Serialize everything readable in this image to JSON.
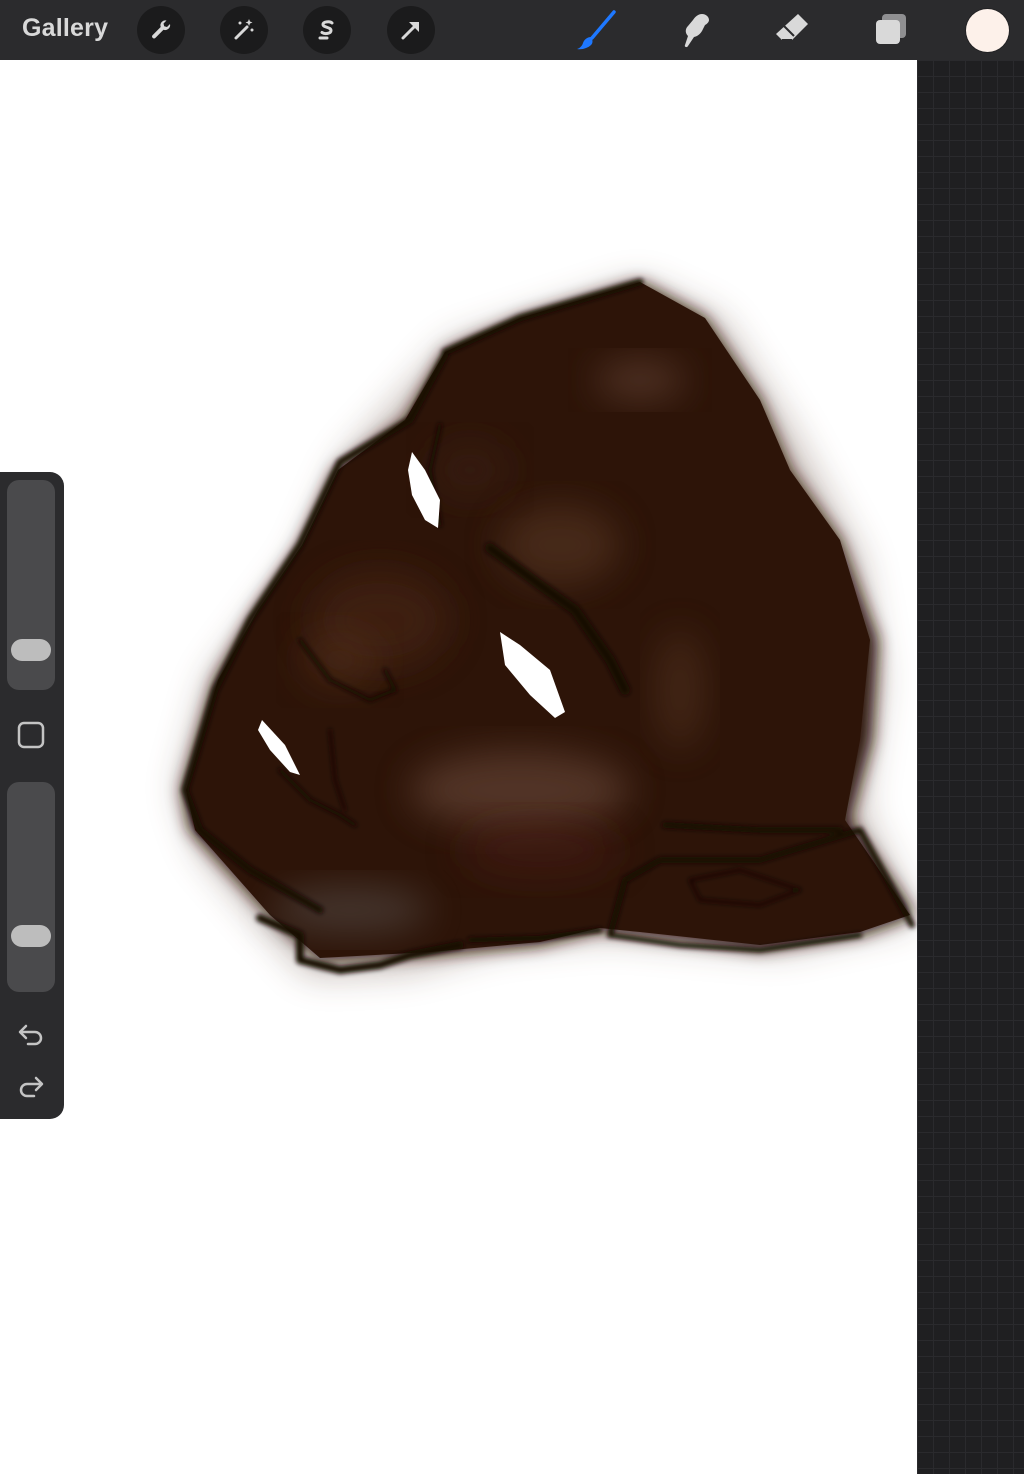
{
  "toolbar": {
    "gallery_label": "Gallery",
    "left_tools": [
      "wrench-icon",
      "magic-wand-icon",
      "selection-icon",
      "transform-arrow-icon"
    ],
    "right_tools": [
      "brush-icon",
      "smudge-icon",
      "eraser-icon",
      "layers-icon"
    ],
    "active_tool": "brush-icon",
    "active_color": "#fdf1ea",
    "accent_color": "#1e78ff"
  },
  "sidebar": {
    "brush_size_level": 0.14,
    "opacity_level": 0.23,
    "modify_icon": "square-icon",
    "undo_icon": "undo-icon",
    "redo_icon": "redo-icon"
  },
  "canvas": {
    "background": "#ffffff",
    "artwork": "face-painting"
  }
}
